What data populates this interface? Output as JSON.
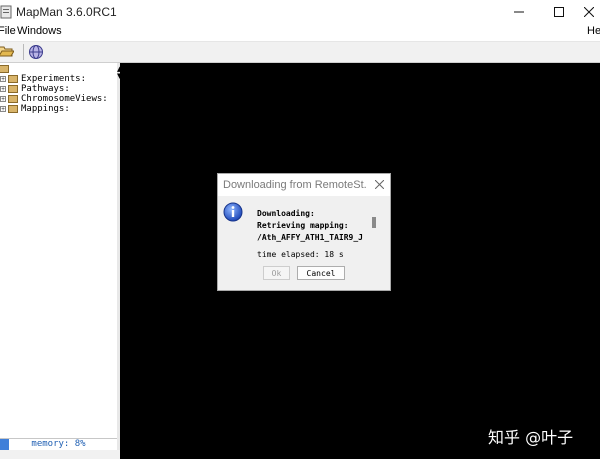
{
  "window": {
    "title": "MapMan 3.6.0RC1"
  },
  "menu": {
    "file": "File",
    "windows": "Windows",
    "help": "He"
  },
  "tree": {
    "items": [
      {
        "label": "Experiments:"
      },
      {
        "label": "Pathways:"
      },
      {
        "label": "ChromosomeViews:"
      },
      {
        "label": "Mappings:"
      }
    ]
  },
  "memory": {
    "label": "memory: 8%",
    "percent": 8
  },
  "dialog": {
    "title": "Downloading from RemoteSt...",
    "line1": "Downloading:",
    "line2": "Retrieving mapping:",
    "line3": "/Ath_AFFY_ATH1_TAIR9_J",
    "time": "time elapsed: 18 s",
    "ok_label": "Ok",
    "cancel_label": "Cancel"
  },
  "watermark": "知乎 @叶子"
}
